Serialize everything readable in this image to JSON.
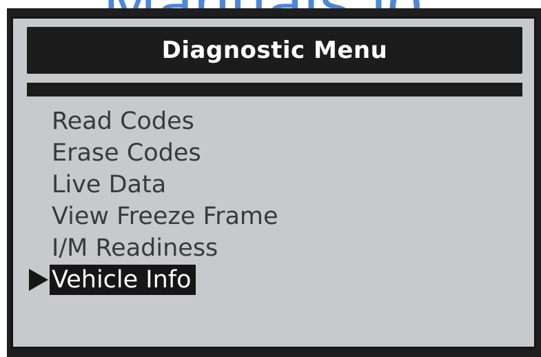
{
  "watermark": {
    "text": "Manuals.io"
  },
  "screen": {
    "title": "Diagnostic Menu",
    "menu_items": [
      {
        "label": "Read Codes",
        "selected": false
      },
      {
        "label": "Erase Codes",
        "selected": false
      },
      {
        "label": "Live Data",
        "selected": false
      },
      {
        "label": "View Freeze Frame",
        "selected": false
      },
      {
        "label": "I/M Readiness",
        "selected": false
      },
      {
        "label": "Vehicle Info",
        "selected": true
      }
    ],
    "selection_cursor_icon": "right-triangle-pointer"
  },
  "colors": {
    "screen_background": "#c8c9cd",
    "bar_dark": "#1c1c1c",
    "menu_text": "#3a3a3a",
    "selected_text": "#ffffff",
    "watermark": "#3b7bd6"
  }
}
